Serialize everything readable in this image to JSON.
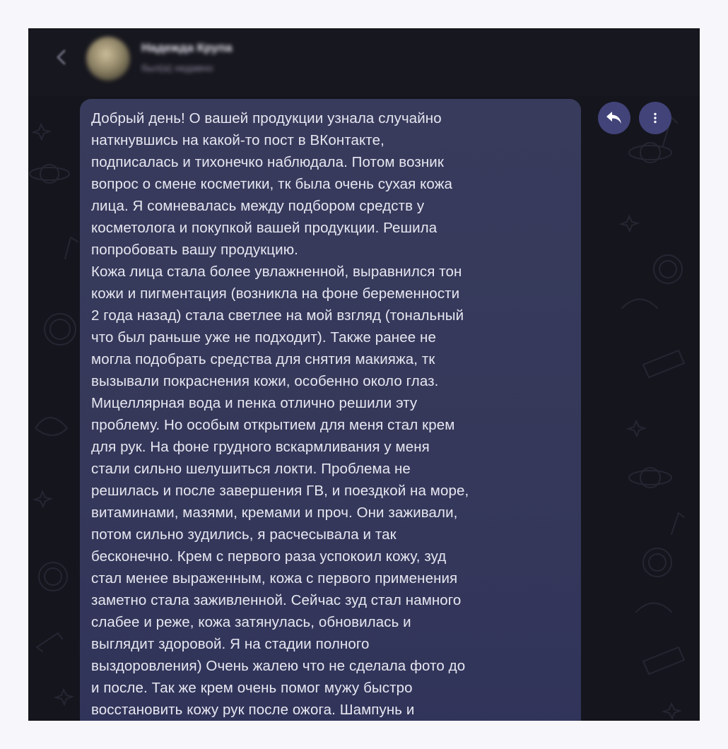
{
  "header": {
    "contact_name": "Надежда Крупа",
    "contact_status": "был(а) недавно"
  },
  "message": {
    "lines": [
      "Добрый день! О вашей продукции узнала случайно",
      "наткнувшись на какой-то пост в ВКонтакте,",
      "подписалась и тихонечко наблюдала. Потом возник",
      "вопрос о смене косметики, тк была очень сухая кожа",
      "лица. Я сомневалась между подбором средств у",
      "косметолога и покупкой вашей продукции. Решила",
      "попробовать вашу продукцию.",
      "Кожа лица стала более увлажненной, выравнился тон",
      "кожи и пигментация (возникла на фоне беременности",
      "2 года назад) стала светлее на мой взгляд (тональный",
      "что был раньше уже не подходит). Также ранее не",
      "могла подобрать средства для снятия макияжа, тк",
      "вызывали покраснения кожи, особенно около глаз.",
      "Мицеллярная вода и пенка отлично решили эту",
      "проблему. Но особым открытием для меня стал крем",
      "для рук. На фоне грудного вскармливания у меня",
      "стали сильно шелушиться локти. Проблема не",
      "решилась и после завершения ГВ, и поездкой на море,",
      "витаминами, мазями, кремами и проч. Они заживали,",
      "потом сильно зудились, я расчесывала и так",
      "бесконечно. Крем с первого раза успокоил кожу, зуд",
      "стал менее выраженным, кожа с первого применения",
      "заметно стала заживленной. Сейчас зуд стал намного",
      "слабее и реже, кожа затянулась, обновилась и",
      "выглядит здоровой. Я на стадии полного",
      "выздоровления) Очень жалею что не сделала фото до",
      "и после. Так же крем очень помог мужу быстро",
      "восстановить кожу рук после ожога. Шампунь и"
    ]
  },
  "icons": {
    "back": "chevron-left-icon",
    "reply": "reply-arrow-icon",
    "more": "vertical-dots-icon"
  },
  "colors": {
    "background": "#15151d",
    "header": "#17171f",
    "bubble": "#383b5c",
    "action_button": "#414379",
    "text": "#e7e7f1"
  }
}
